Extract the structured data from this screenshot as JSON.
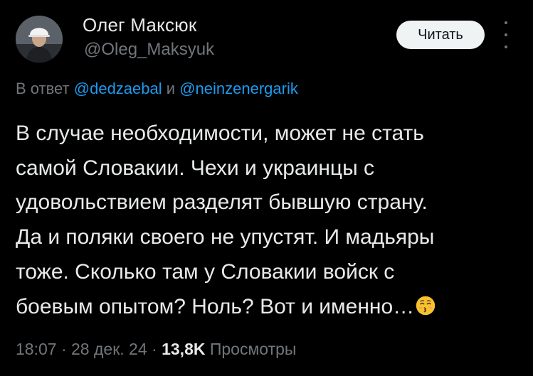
{
  "author": {
    "name": "Олег Максюк",
    "handle": "@Oleg_Maksyuk"
  },
  "follow_button": {
    "label": "Читать"
  },
  "more_button": {
    "icon": "more-vertical-icon"
  },
  "reply_context": {
    "prefix": "В ответ",
    "mention_1": "@dedzaebal",
    "conjunction": "и",
    "mention_2": "@neinzenergarik"
  },
  "tweet_text_lines": [
    "В случае необходимости, может не стать",
    "самой Словакии. Чехи и украинцы с",
    "удовольствием разделят бывшую страну.",
    "Да и поляки своего не упустят. И мадьяры",
    "тоже. Сколько там у Словакии войск с",
    "боевым опытом? Ноль? Вот и именно…"
  ],
  "tweet_emoji": "kissing-face-icon",
  "meta": {
    "time": "18:07",
    "separator": "·",
    "date": "28 дек. 24",
    "views_count": "13,8K",
    "views_label": "Просмотры"
  },
  "colors": {
    "background": "#000000",
    "text_primary": "#e7e9ea",
    "text_secondary": "#71767b",
    "link": "#1d9bf0",
    "button_bg": "#eff3f4",
    "emoji_yellow": "#f7c22f"
  }
}
